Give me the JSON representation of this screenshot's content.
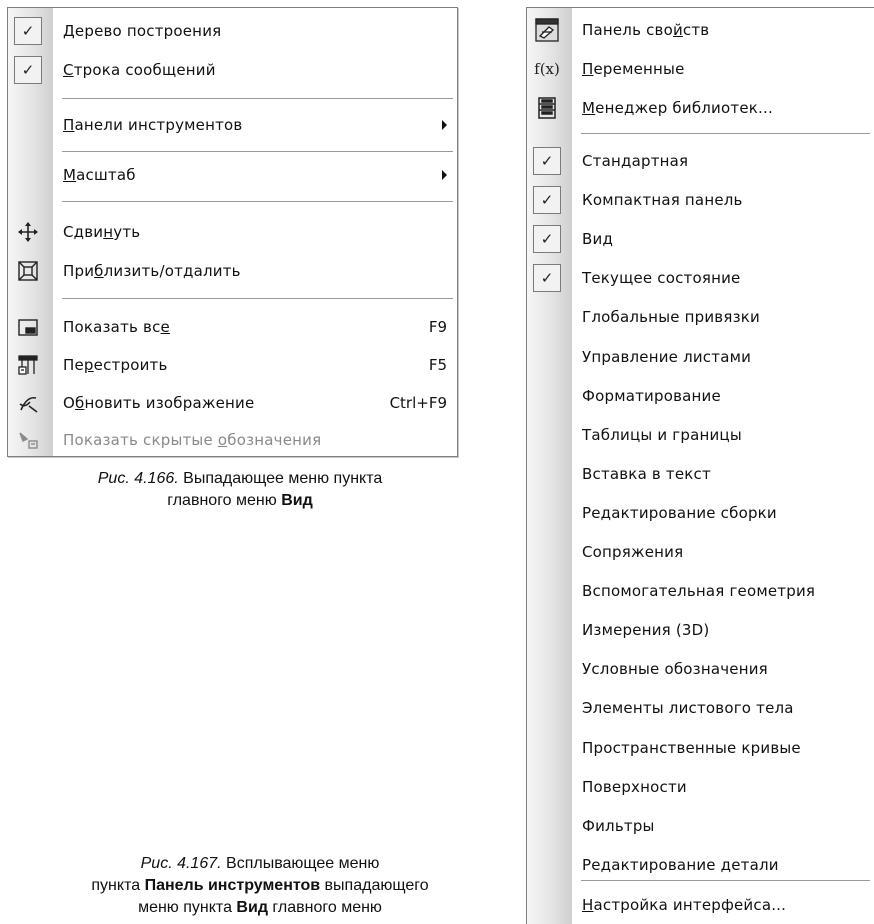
{
  "view_menu": {
    "items": [
      {
        "pre": "",
        "ul": "Д",
        "post": "ерево построения",
        "checked": true
      },
      {
        "pre": "",
        "ul": "С",
        "post": "трока сообщений",
        "checked": true
      },
      {
        "pre": "",
        "ul": "П",
        "post": "анели инструментов",
        "submenu": true
      },
      {
        "pre": "",
        "ul": "М",
        "post": "асштаб",
        "submenu": true
      },
      {
        "pre": "Сдви",
        "ul": "н",
        "post": "уть",
        "icon": "pan-icon"
      },
      {
        "pre": "При",
        "ul": "б",
        "post": "лизить/отдалить",
        "icon": "zoom-window-icon"
      },
      {
        "pre": "Показать вс",
        "ul": "е",
        "post": "",
        "shortcut": "F9",
        "icon": "show-all-icon"
      },
      {
        "pre": "Пе",
        "ul": "р",
        "post": "естроить",
        "shortcut": "F5",
        "icon": "rebuild-icon"
      },
      {
        "pre": "О",
        "ul": "б",
        "post": "новить изображение",
        "shortcut": "Ctrl+F9",
        "icon": "refresh-icon"
      },
      {
        "pre": "Показать скрытые ",
        "ul": "о",
        "post": "бозначения",
        "disabled": true,
        "icon": "hidden-designations-icon"
      }
    ]
  },
  "toolbars_menu": {
    "top_items": [
      {
        "pre": "Панель сво",
        "ul": "й",
        "post": "ств",
        "icon": "properties-panel-icon"
      },
      {
        "pre": "",
        "ul": "П",
        "post": "еременные",
        "icon": "variables-icon",
        "icon_text": "f(x)"
      },
      {
        "pre": "",
        "ul": "М",
        "post": "енеджер библиотек...",
        "icon": "library-manager-icon"
      }
    ],
    "toolbars": [
      {
        "label": "Стандартная",
        "checked": true
      },
      {
        "label": "Компактная панель",
        "checked": true
      },
      {
        "label": "Вид",
        "checked": true
      },
      {
        "label": "Текущее состояние",
        "checked": true
      },
      {
        "label": "Глобальные привязки"
      },
      {
        "label": "Управление листами"
      },
      {
        "label": "Форматирование"
      },
      {
        "label": "Таблицы и границы"
      },
      {
        "label": "Вставка в текст"
      },
      {
        "label": "Редактирование сборки"
      },
      {
        "label": "Сопряжения"
      },
      {
        "label": "Вспомогательная геометрия"
      },
      {
        "label": "Измерения (3D)"
      },
      {
        "label": "Условные обозначения"
      },
      {
        "label": "Элементы листового тела"
      },
      {
        "label": "Пространственные кривые"
      },
      {
        "label": "Поверхности"
      },
      {
        "label": "Фильтры"
      },
      {
        "label": "Редактирование детали"
      }
    ],
    "bottom_item": {
      "pre": "",
      "ul": "Н",
      "post": "астройка интерфейса..."
    }
  },
  "captions": {
    "fig166_num": "Рис. 4.166.",
    "fig166_text": " Выпадающее меню пункта",
    "fig166_line2_pre": "главного меню ",
    "fig166_line2_bold": "Вид",
    "fig167_num": "Рис. 4.167.",
    "fig167_text": " Всплывающее меню",
    "fig167_line2_pre": "пункта ",
    "fig167_line2_bold": "Панель инструментов",
    "fig167_line2_post": " выпадающего",
    "fig167_line3_pre": "меню пункта ",
    "fig167_line3_bold": "Вид",
    "fig167_line3_post": " главного меню"
  },
  "colors": {
    "menu_border": "#7f7f7f",
    "gutter": "#e4e4e4",
    "disabled_text": "#8a8a8a"
  }
}
